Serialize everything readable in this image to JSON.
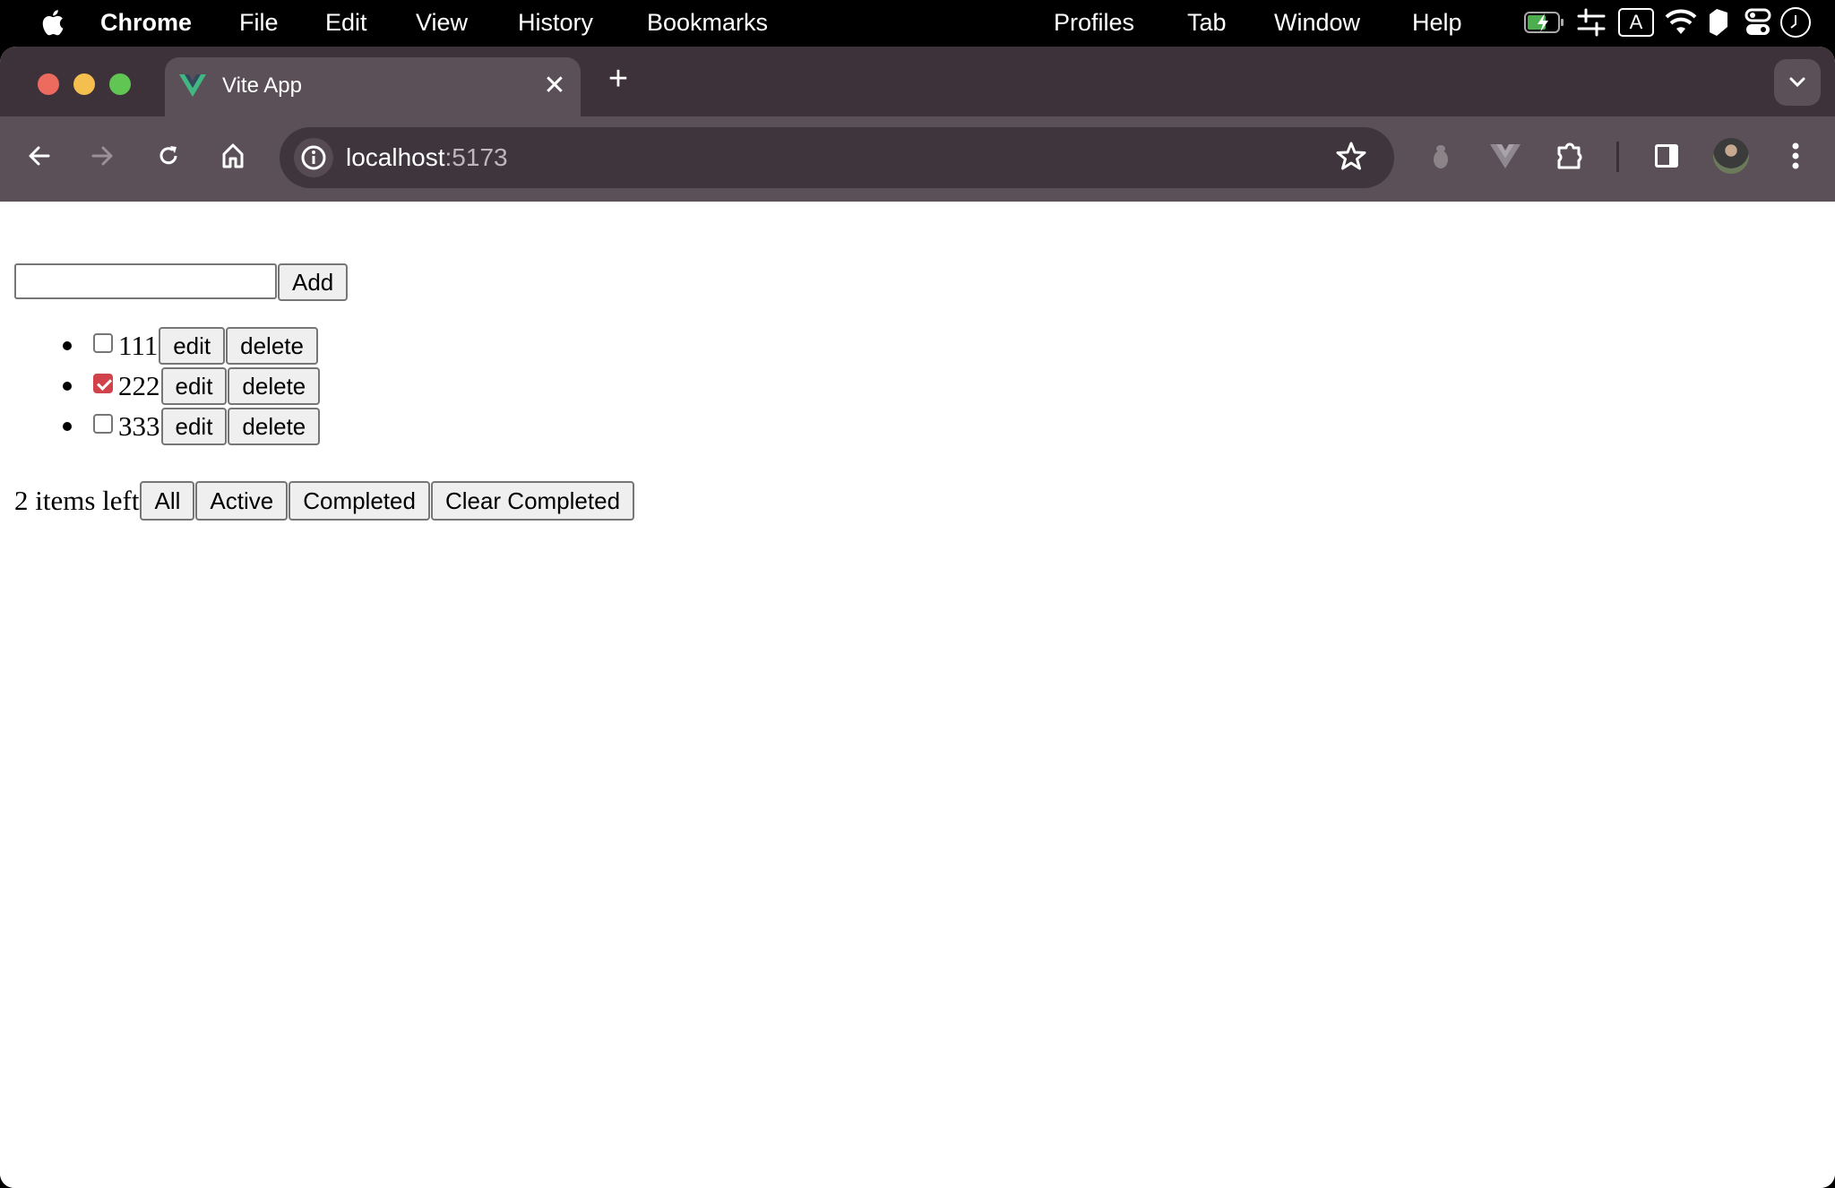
{
  "menubar": {
    "app_name": "Chrome",
    "items": [
      "File",
      "Edit",
      "View",
      "History",
      "Bookmarks",
      "Profiles",
      "Tab",
      "Window",
      "Help"
    ],
    "tray_icons": [
      "battery-charging-icon",
      "sliders-icon",
      "input-source-icon",
      "wifi-icon",
      "bookmark-app-icon",
      "control-center-icon",
      "clock-icon"
    ],
    "input_source_label": "A"
  },
  "browser": {
    "tab_title": "Vite App",
    "url_host": "localhost",
    "url_port": ":5173"
  },
  "colors": {
    "checkbox_accent": "#d1424a",
    "toolbar_bg": "#5c5058",
    "tabstrip_bg": "#3d3239"
  },
  "app": {
    "new_todo_value": "",
    "add_label": "Add",
    "todos": [
      {
        "text": "111",
        "completed": false,
        "edit_label": "edit",
        "delete_label": "delete"
      },
      {
        "text": "222",
        "completed": true,
        "edit_label": "edit",
        "delete_label": "delete"
      },
      {
        "text": "333",
        "completed": false,
        "edit_label": "edit",
        "delete_label": "delete"
      }
    ],
    "footer": {
      "items_left": "2 items left",
      "filters": [
        "All",
        "Active",
        "Completed"
      ],
      "clear_completed_label": "Clear Completed"
    }
  }
}
